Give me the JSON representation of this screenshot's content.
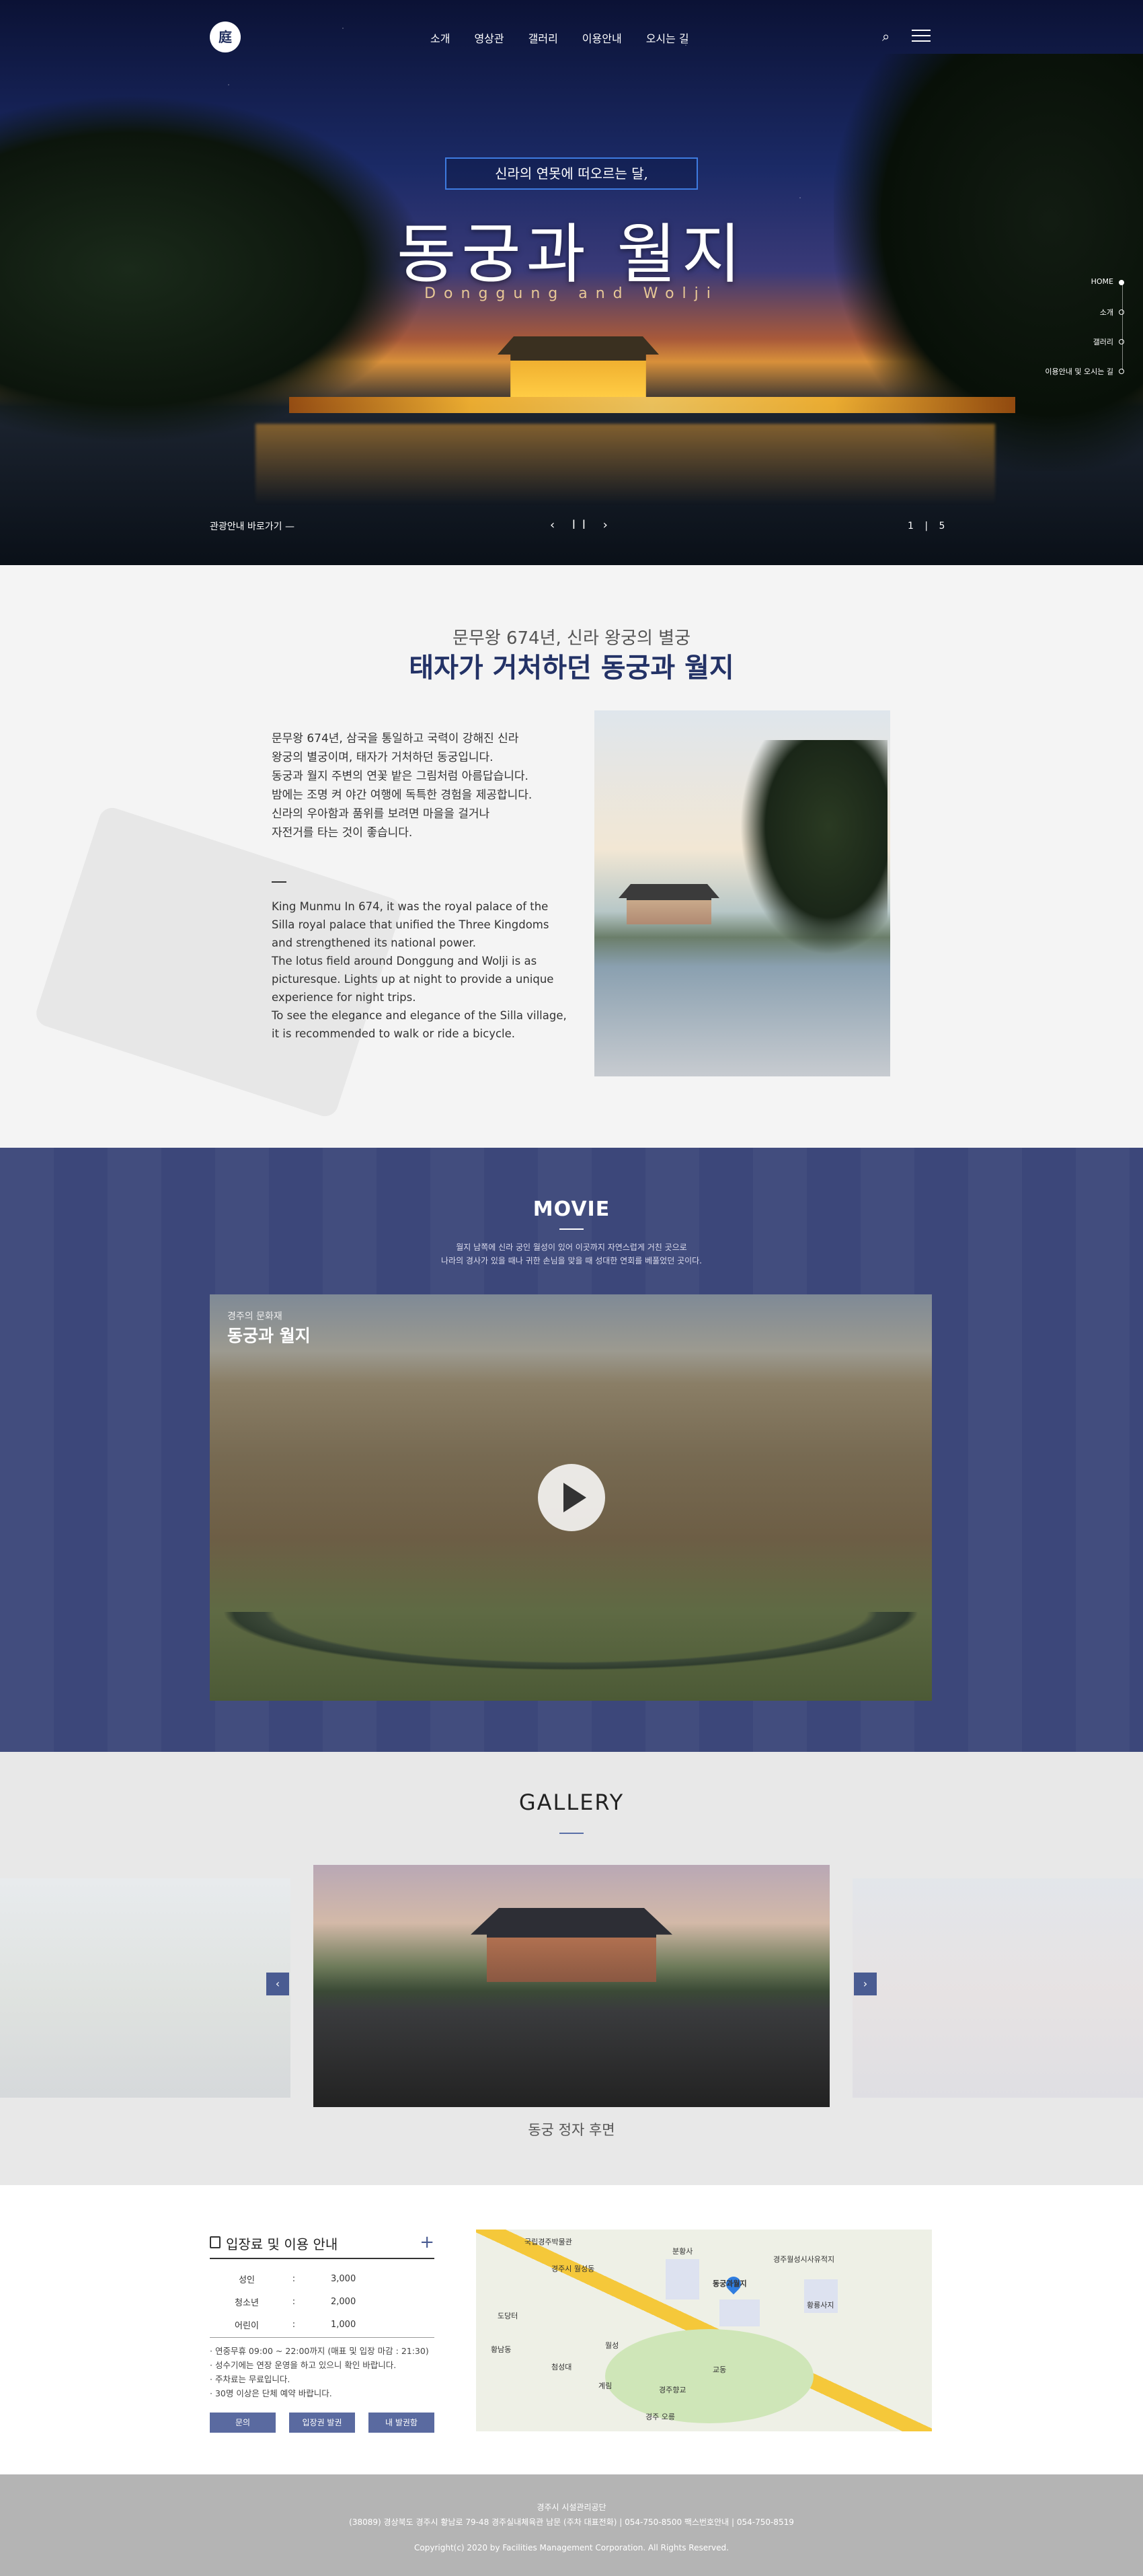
{
  "nav": {
    "logo": "庭",
    "items": [
      "소개",
      "영상관",
      "갤러리",
      "이용안내",
      "오시는 길"
    ],
    "search_icon": "search-icon",
    "menu_icon": "hamburger-icon"
  },
  "hero": {
    "tagline": "신라의 연못에 떠오르는 달,",
    "title": "동궁과 월지",
    "subtitle": "Donggung and Wolji",
    "side_nav": [
      "HOME",
      "소개",
      "갤러리",
      "이용안내 및 오시는 길"
    ],
    "guide_link": "관광안내 바로가기  —",
    "controls": "‹ ll ›",
    "pager": "1 | 5"
  },
  "intro": {
    "subtitle": "문무왕 674년, 신라 왕궁의 별궁",
    "title": "태자가 거처하던 동궁과 월지",
    "ko_lines": [
      "문무왕 674년, 삼국을 통일하고 국력이 강해진 신라",
      "왕궁의 별궁이며, 태자가 거처하던 동궁입니다.",
      "동궁과 월지 주변의 연꽃 밭은 그림처럼 아름답습니다.",
      "밤에는 조명 켜 야간 여행에 독특한 경험을 제공합니다.",
      "신라의 우아함과 품위를 보려면 마을을 걸거나",
      "자전거를 타는 것이 좋습니다."
    ],
    "en_lines": [
      "King Munmu In 674, it was the royal palace of the",
      "Silla royal palace that unified the Three Kingdoms",
      "and strengthened its national power.",
      "The lotus field around Donggung and Wolji is as",
      "picturesque. Lights up at night to provide a unique",
      "experience for night trips.",
      "To see the elegance and elegance of the Silla village,",
      "it is recommended to walk or ride a bicycle."
    ]
  },
  "movie": {
    "title": "MOVIE",
    "desc1": "월지 남쪽에 신라 궁인 월성이 있어 이곳까지 자연스럽게 거친 곳으로",
    "desc2": "나라의 경사가 있을 때나 귀한 손님을 맞을 때 성대한 연회를 베풀었던 곳이다.",
    "caption_small": "경주의 문화재",
    "caption_big": "동궁과 월지",
    "play_icon": "play-icon"
  },
  "gallery": {
    "title": "GALLERY",
    "caption": "동궁 정자 후면",
    "prev": "‹",
    "next": "›"
  },
  "info": {
    "title": "입장료 및 이용 안내",
    "plus": "+",
    "fees": [
      {
        "k": "성인",
        "c": ":",
        "v": "3,000"
      },
      {
        "k": "청소년",
        "c": ":",
        "v": "2,000"
      },
      {
        "k": "어린이",
        "c": ":",
        "v": "1,000"
      }
    ],
    "notes": [
      "· 연중무휴 09:00 ~ 22:00까지 (매표 및 입장 마감 : 21:30)",
      "· 성수기에는 연장 운영을 하고 있으니 확인 바랍니다.",
      "· 주차료는 무료입니다.",
      "· 30명 이상은 단체 예약 바랍니다."
    ],
    "buttons": [
      "문의",
      "입장권 발권",
      "내 발권함"
    ]
  },
  "map": {
    "labels": [
      "국립경주박물관",
      "경주시 월성동",
      "동궁과월지",
      "경주월성시사유적지",
      "황룡사지",
      "월성",
      "분황사",
      "황남동",
      "첨성대",
      "계림",
      "경주향교",
      "교동",
      "도당터",
      "경주 오릉"
    ]
  },
  "footer": {
    "line1": "경주시 시설관리공단",
    "line2": "(38089) 경상북도 경주시 황남로 79-48 경주실내체육관 남문 (주차 대표전화) | 054-750-8500 팩스번호안내 | 054-750-8519",
    "line3": "Copyright(c) 2020 by Facilities Management Corporation. All Rights Reserved."
  }
}
